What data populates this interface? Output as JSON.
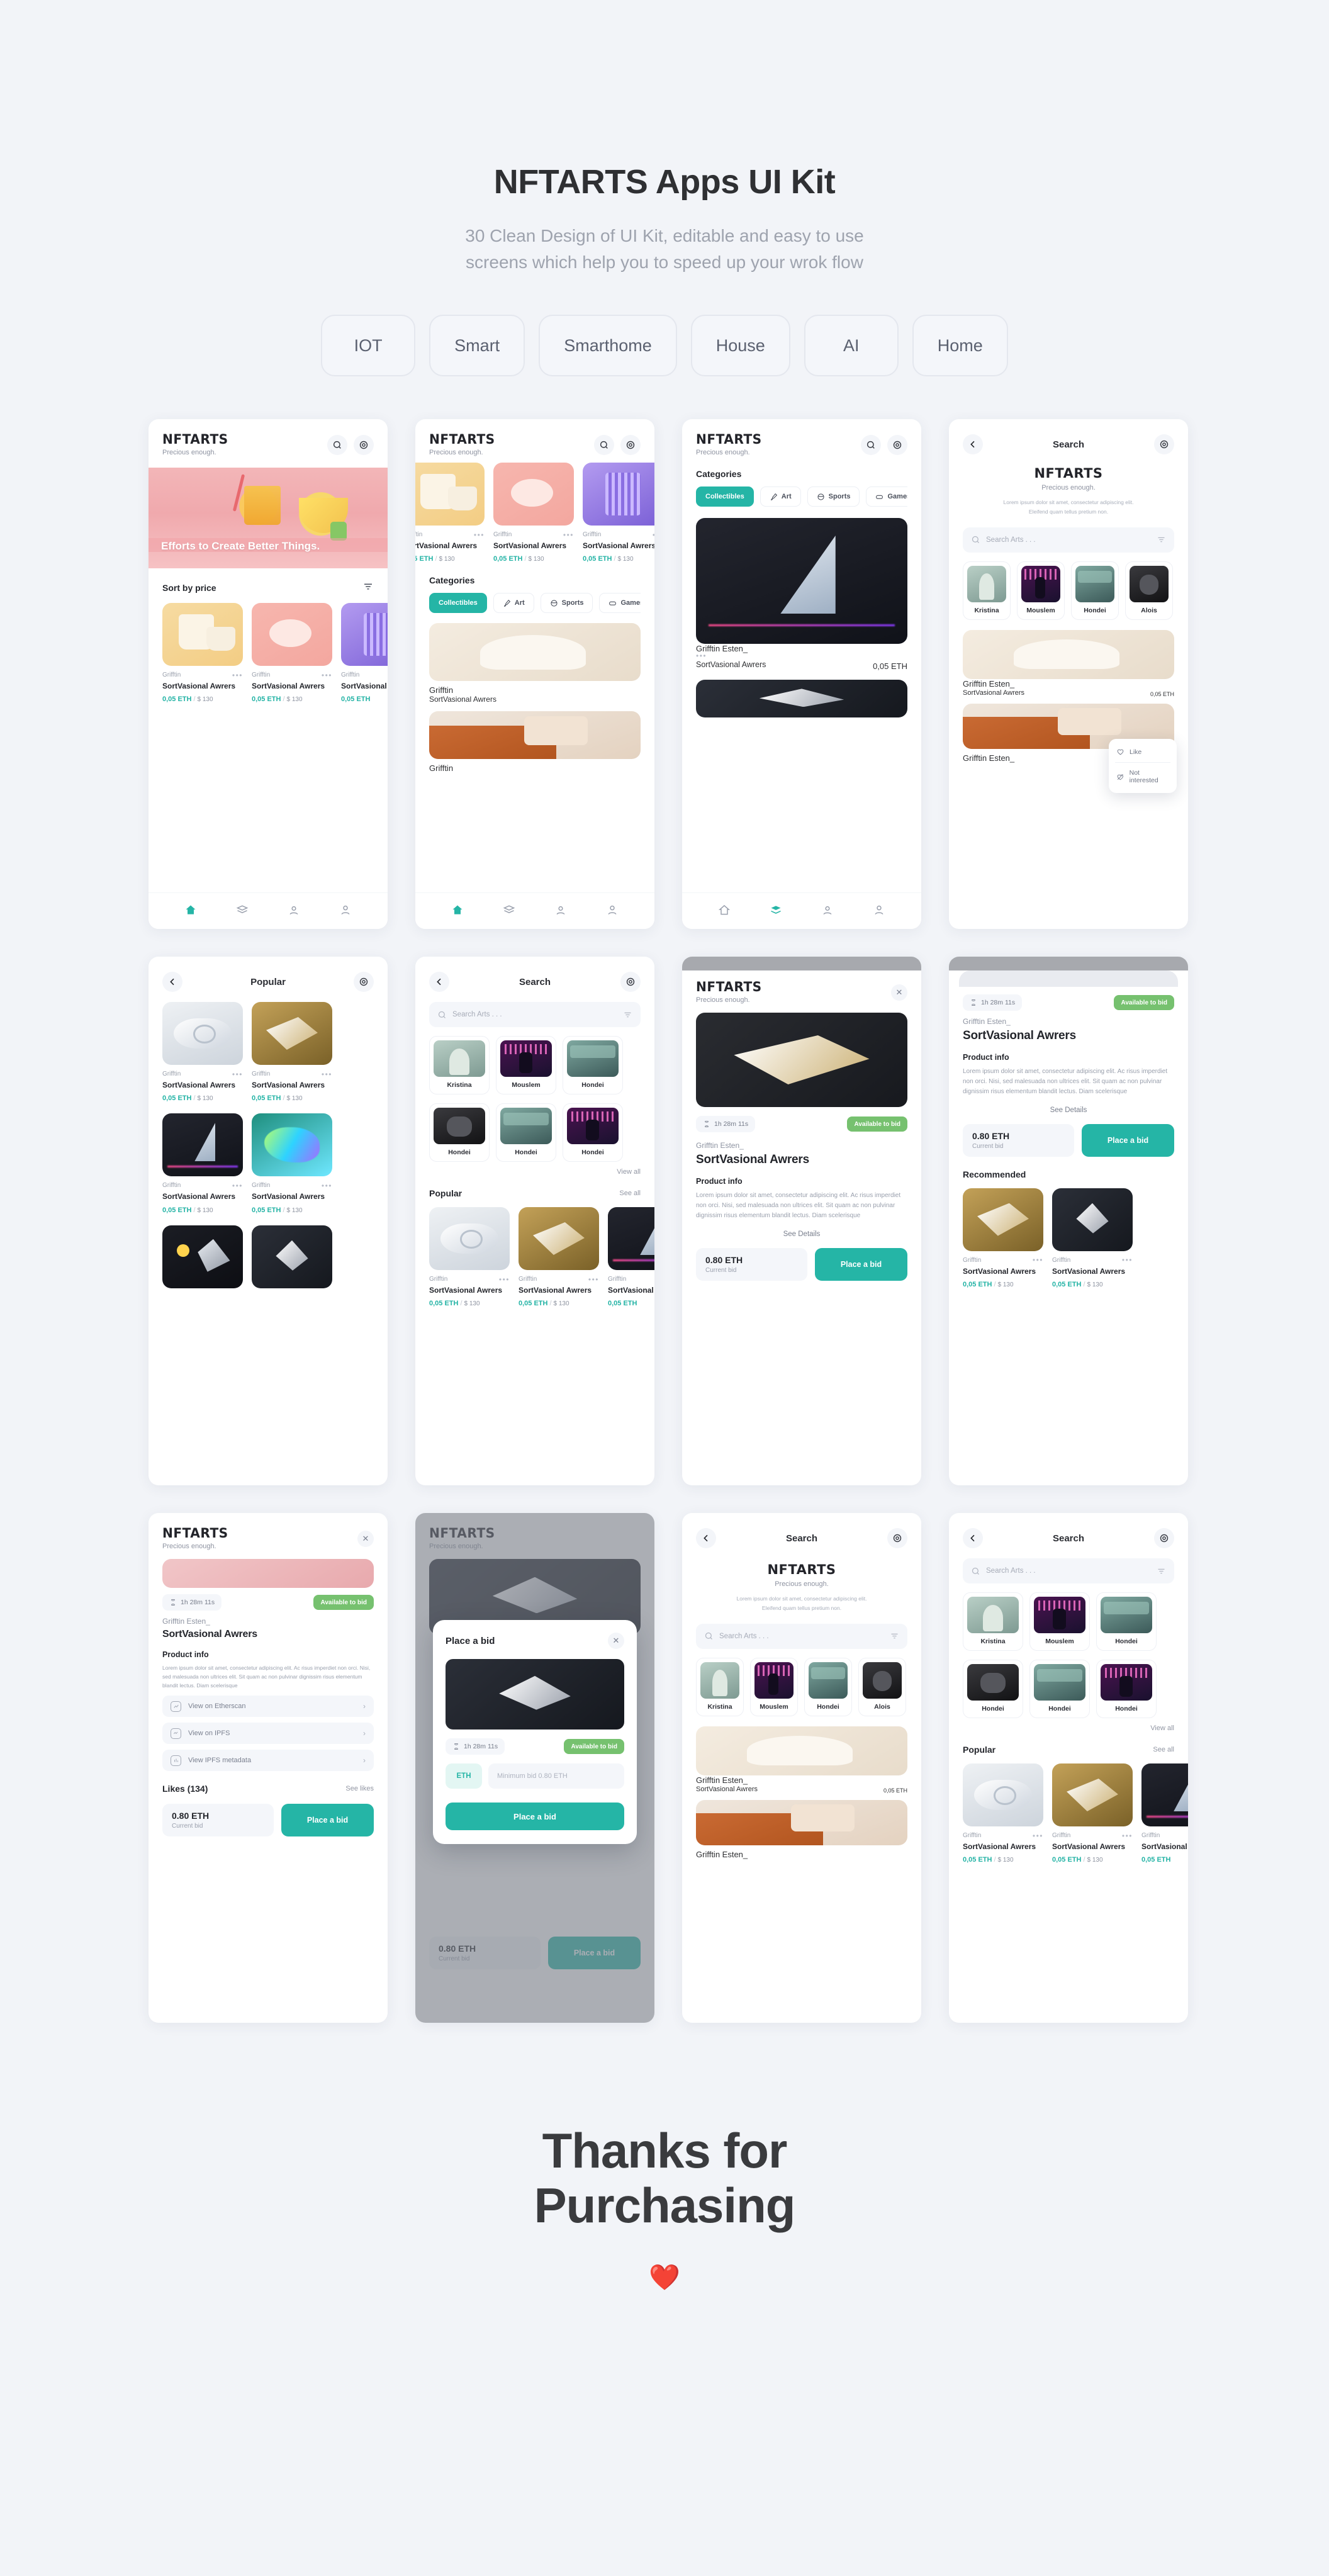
{
  "hero": {
    "title": "NFTARTS Apps UI Kit",
    "subtitle_line1": "30 Clean Design of UI Kit, editable and easy to use",
    "subtitle_line2": "screens which help you to speed up your wrok flow",
    "chips": [
      "IOT",
      "Smart",
      "Smarthome",
      "House",
      "AI",
      "Home"
    ]
  },
  "brand": {
    "name": "NFTARTS",
    "tagline": "Precious enough."
  },
  "common": {
    "search_placeholder": "Search Arts . . .",
    "author": "Grifftin",
    "author_full": "Grifftin Esten_",
    "product_name": "SortVasional Awrers",
    "price_eth": "0,05 ETH",
    "price_sep": "/",
    "price_usd": "$ 130",
    "dots": "•••",
    "timer": "1h 28m 11s",
    "badge_available": "Available to bid",
    "current_bid_amount": "0.80 ETH",
    "current_bid_label": "Current bid",
    "place_a_bid": "Place a bid",
    "see_details": "See Details",
    "product_info_title": "Product info",
    "product_info_body": "Lorem ipsum dolor sit amet, consectetur adipiscing elit. Ac risus imperdiet non orci. Nisi, sed malesuada non ultrices elit. Sit quam ac non pulvinar dignissim risus elementum blandit lectus. Diam scelerisque",
    "lorem_short_line1": "Lorem ipsum dolor sit amet, consectetur adipiscing elit.",
    "lorem_short_line2": "Eleifend quam tellus pretium non.",
    "view_all": "View all",
    "see_all": "See all",
    "popular": "Popular",
    "recommended": "Recommended",
    "categories_title": "Categories",
    "sort_by_price": "Sort by price",
    "back_arrow": "←"
  },
  "categories": [
    "Collectibles",
    "Art",
    "Sports",
    "Games"
  ],
  "creators": [
    "Kristina",
    "Mouslem",
    "Hondei",
    "Alois"
  ],
  "creators_row2": [
    "Hondei",
    "Hondei",
    "Hondei"
  ],
  "popup_menu": {
    "like": "Like",
    "not_interested": "Not interested"
  },
  "screens": {
    "home": {
      "nav_title": "",
      "banner_title": "Efforts to Create Better Things."
    },
    "search": {
      "nav_title": "Search"
    },
    "popular": {
      "nav_title": "Popular"
    },
    "detail": {
      "etherscan": "View on Etherscan",
      "ipfs": "View on IPFS",
      "ipfs_meta": "View IPFS metadata",
      "likes": "Likes (134)",
      "see_likes": "See likes"
    },
    "bid_modal": {
      "title": "Place a bid",
      "eth_tag": "ETH",
      "input_placeholder": "Minimum bid 0.80 ETH",
      "cta": "Place a bid",
      "close": "✕"
    }
  },
  "footer": {
    "line1": "Thanks for",
    "line2": "Purchasing",
    "heart": "❤️"
  },
  "colors": {
    "accent": "#25b5a6",
    "page_bg": "#f2f4f8",
    "green_badge": "#76c16f",
    "text_dark": "#23252b",
    "text_muted": "#9aa0ad"
  }
}
